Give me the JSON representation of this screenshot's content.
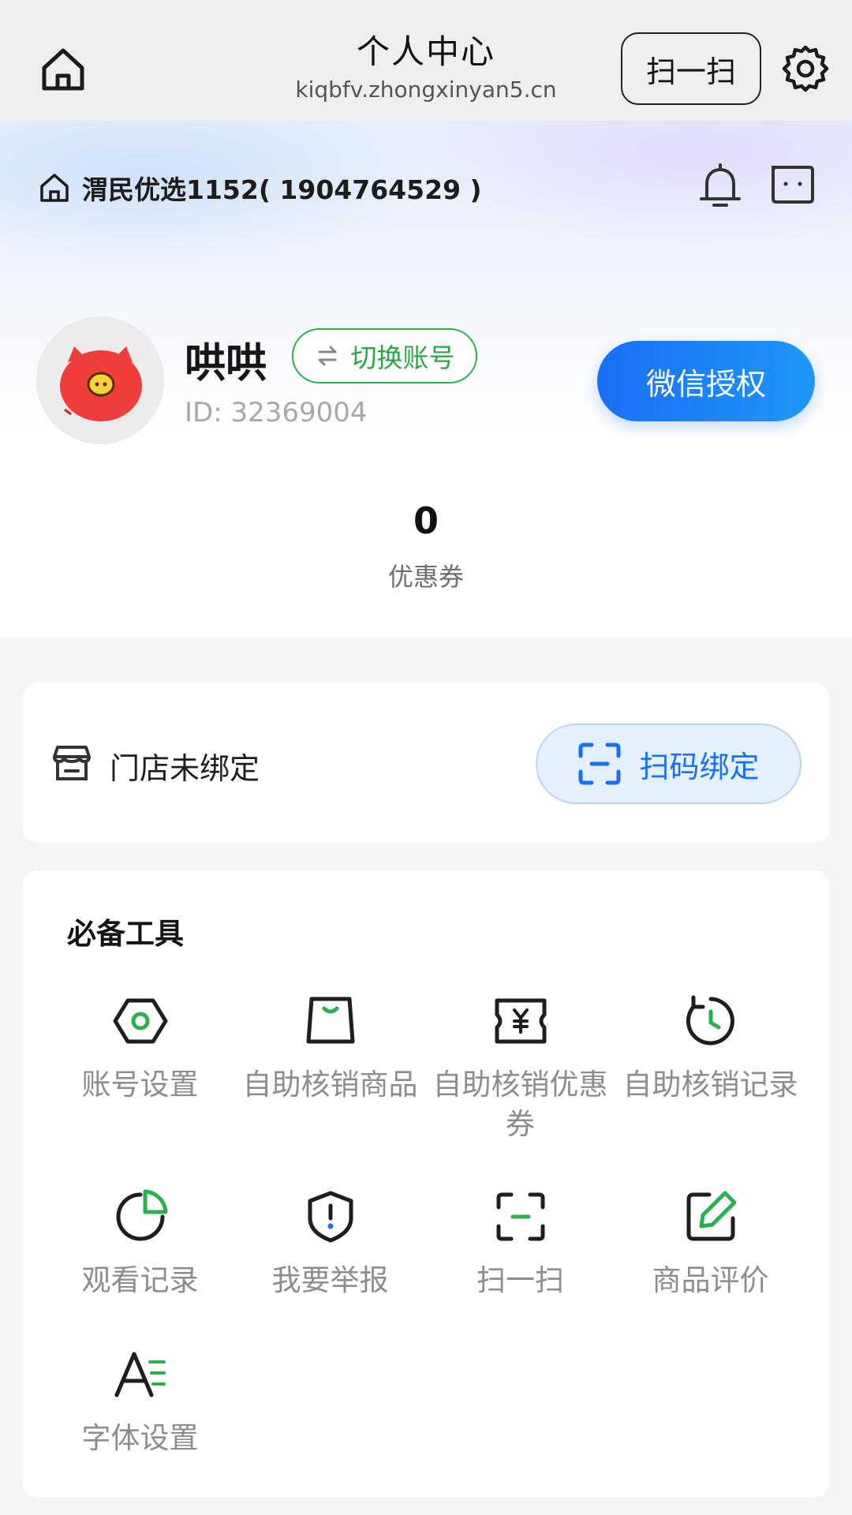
{
  "header": {
    "title": "个人中心",
    "url": "kiqbfv.zhongxinyan5.cn",
    "scan_label": "扫一扫"
  },
  "store": {
    "name": "渭民优选1152( 1904764529 )"
  },
  "user": {
    "nickname": "哄哄",
    "switch_label": "切换账号",
    "id_text": "ID: 32369004",
    "wechat_auth_label": "微信授权",
    "coupon_count": "0",
    "coupon_label": "优惠券"
  },
  "binding": {
    "status_text": "门店未绑定",
    "scan_bind_label": "扫码绑定"
  },
  "tools": {
    "title": "必备工具",
    "items": [
      {
        "label": "账号设置",
        "icon": "hexagon-settings-icon"
      },
      {
        "label": "自助核销商品",
        "icon": "shopping-bag-icon"
      },
      {
        "label": "自助核销优惠券",
        "icon": "ticket-yen-icon"
      },
      {
        "label": "自助核销记录",
        "icon": "history-clock-icon"
      },
      {
        "label": "观看记录",
        "icon": "pie-chart-icon"
      },
      {
        "label": "我要举报",
        "icon": "shield-alert-icon"
      },
      {
        "label": "扫一扫",
        "icon": "scan-icon"
      },
      {
        "label": "商品评价",
        "icon": "edit-review-icon"
      },
      {
        "label": "字体设置",
        "icon": "font-size-icon"
      }
    ]
  },
  "colors": {
    "accent_green": "#2bb04f",
    "accent_blue": "#1a6ff5",
    "background": "#f4f5f7"
  }
}
